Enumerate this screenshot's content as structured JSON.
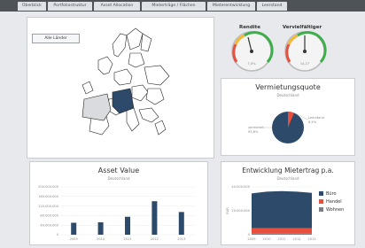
{
  "tabs": [
    {
      "label": "Überblick",
      "active": true
    },
    {
      "label": "Portfoliostruktur",
      "active": false
    },
    {
      "label": "Asset Allocation",
      "active": false
    },
    {
      "label": "Mieterträge / Flächen",
      "active": false
    },
    {
      "label": "Mieterentwicklung",
      "active": false
    },
    {
      "label": "Leerstand",
      "active": false
    }
  ],
  "map": {
    "button_label": "Alle Länder"
  },
  "gauges": [
    {
      "title": "Rendite",
      "value": "7,0%",
      "level": 0.42
    },
    {
      "title": "Vervielfältiger",
      "value": "14,27",
      "level": 0.5
    }
  ],
  "vermietungsquote": {
    "title": "Vermietungsquote",
    "subtitle": "Deutschland",
    "chart_data": {
      "type": "pie",
      "slices": [
        {
          "name": "vermietet",
          "value": 93.6
        },
        {
          "name": "Leerstand",
          "value": 6.4
        }
      ],
      "labels": {
        "left": "vermietet\n93,6%",
        "right": "Leerstand\n6,4%"
      }
    }
  },
  "asset_value": {
    "title": "Asset Value",
    "subtitle": "Deutschland",
    "chart_data": {
      "type": "bar",
      "categories": [
        "2009",
        "2010",
        "2011",
        "2012",
        "2013"
      ],
      "values": [
        50000000,
        52000000,
        75000000,
        140000000,
        95000000
      ],
      "yticks": [
        "200.000.000",
        "160.000.000",
        "120.000.000",
        "80.000.000",
        "40.000.000",
        "0"
      ],
      "ylim": [
        0,
        200000000
      ]
    }
  },
  "mietertrag": {
    "title": "Entwicklung Mietertrag p.a.",
    "subtitle": "Deutschland",
    "chart_data": {
      "type": "area",
      "x": [
        "2009",
        "2010",
        "2011",
        "2012",
        "2013"
      ],
      "series": [
        {
          "name": "Büro",
          "values": [
            29000000,
            30500000,
            31000000,
            30500000,
            29500000
          ]
        },
        {
          "name": "Handel",
          "values": [
            4500000,
            4500000,
            4500000,
            4500000,
            4500000
          ]
        },
        {
          "name": "Wohnen",
          "values": [
            1000000,
            1000000,
            1000000,
            1000000,
            1000000
          ]
        }
      ],
      "yticks": [
        "40.000.000",
        "20.000.000",
        "0"
      ],
      "ylim": [
        0,
        40000000
      ],
      "ylabel": "EUR"
    },
    "colors": {
      "Büro": "#2e4a6b",
      "Handel": "#e94f3d",
      "Wohnen": "#7c7f84"
    }
  }
}
